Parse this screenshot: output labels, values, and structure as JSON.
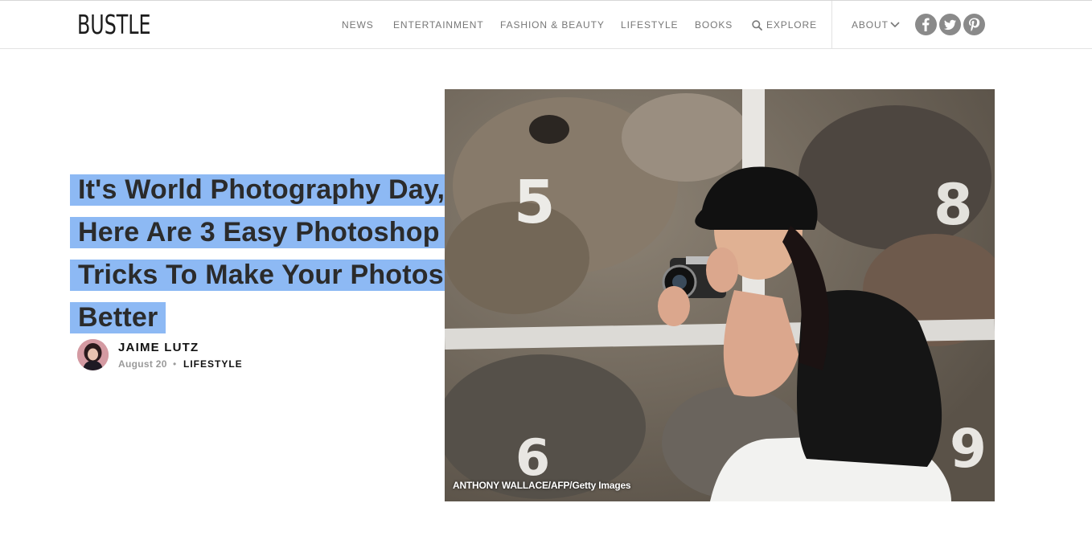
{
  "header": {
    "logo": "BUSTLE",
    "nav": [
      {
        "label": "NEWS"
      },
      {
        "label": "ENTERTAINMENT"
      },
      {
        "label": "FASHION & BEAUTY"
      },
      {
        "label": "LIFESTYLE"
      },
      {
        "label": "BOOKS"
      },
      {
        "label": "EXPLORE",
        "icon": "search-icon"
      }
    ],
    "about": {
      "label": "ABOUT",
      "icon": "chevron-down-icon"
    },
    "social": [
      {
        "icon": "facebook-icon"
      },
      {
        "icon": "twitter-icon"
      },
      {
        "icon": "pinterest-icon"
      }
    ]
  },
  "article": {
    "headline_lines": [
      "It's World Photography Day, So",
      "Here Are 3 Easy Photoshop",
      "Tricks To Make Your Photos Way",
      "Better"
    ],
    "author": "JAIME LUTZ",
    "date": "August 20",
    "separator": "•",
    "category": "LIFESTYLE",
    "image_credit": "ANTHONY WALLACE/AFP/Getty Images"
  },
  "colors": {
    "highlight": "#8db9f4",
    "social_icon_bg": "#8a8a8a",
    "nav_text": "#777777"
  }
}
